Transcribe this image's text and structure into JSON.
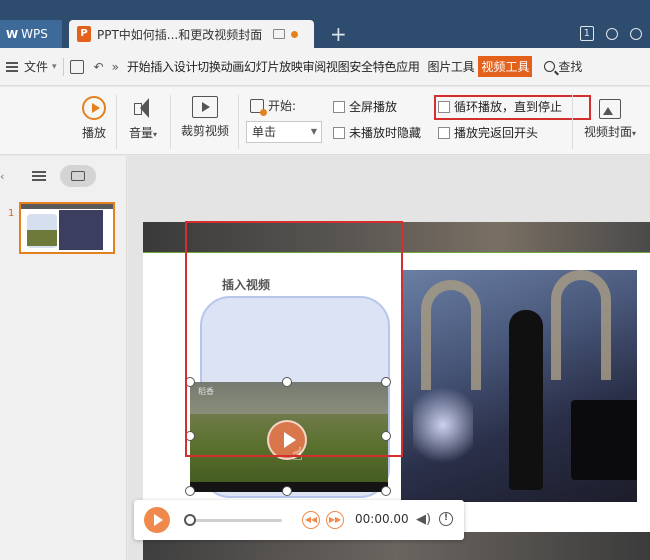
{
  "titlebar": {
    "app_label": "WPS",
    "doc_title": "PPT中如何插...和更改视频封面",
    "new_tab": "+",
    "badge": "1"
  },
  "menubar": {
    "file": "文件",
    "items": [
      "开始",
      "插入",
      "设计",
      "切换",
      "动画",
      "幻灯片放映",
      "审阅",
      "视图",
      "安全",
      "特色应用"
    ],
    "picture_tools": "图片工具",
    "video_tools": "视频工具",
    "search": "查找"
  },
  "ribbon": {
    "play": "播放",
    "volume": "音量",
    "trim": "裁剪视频",
    "start_label": "开始:",
    "start_value": "单击",
    "fullscreen": "全屏播放",
    "hide_not_playing": "未播放时隐藏",
    "loop": "循环播放，直到停止",
    "rewind": "播放完返回开头",
    "cover": "视频封面"
  },
  "thumbs": {
    "slide_number": "1"
  },
  "slide": {
    "insert_title": "插入视频",
    "video_tag": "稻香"
  },
  "control": {
    "time": "00:00.00"
  },
  "colors": {
    "accent": "#e4611c",
    "highlight": "#d32f2f",
    "titlebar": "#2e4c6e"
  }
}
